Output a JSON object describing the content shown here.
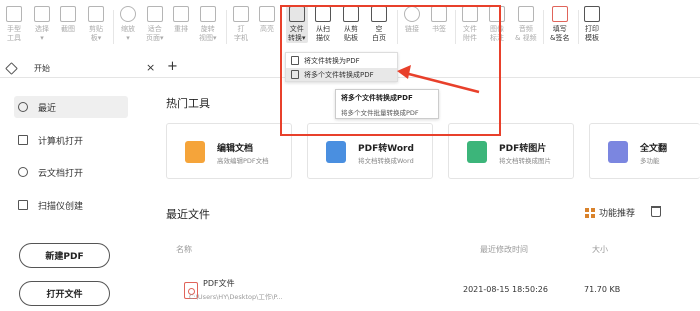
{
  "toolbar": {
    "tools": [
      {
        "name": "hand-tool",
        "label1": "手型",
        "label2": "工具"
      },
      {
        "name": "select-tool",
        "label1": "选择",
        "label2": "▾"
      },
      {
        "name": "screenshot-tool",
        "label1": "截图",
        "label2": ""
      },
      {
        "name": "clipboard-tool",
        "label1": "剪贴",
        "label2": "板▾"
      },
      {
        "name": "zoom-tool",
        "label1": "缩放",
        "label2": "▾"
      },
      {
        "name": "fit-page-tool",
        "label1": "适合",
        "label2": "页面▾"
      },
      {
        "name": "reflow-tool",
        "label1": "重排",
        "label2": ""
      },
      {
        "name": "rotate-view-tool",
        "label1": "旋转",
        "label2": "视图▾"
      },
      {
        "name": "typewriter-tool",
        "label1": "打",
        "label2": "字机"
      },
      {
        "name": "highlight-tool",
        "label1": "高亮",
        "label2": ""
      },
      {
        "name": "file-convert-tool",
        "label1": "文件",
        "label2": "转换▾"
      },
      {
        "name": "from-scanner-tool",
        "label1": "从扫",
        "label2": "描仪"
      },
      {
        "name": "from-clipboard-tool",
        "label1": "从剪",
        "label2": "贴板"
      },
      {
        "name": "blank-page-tool",
        "label1": "空",
        "label2": "白页"
      },
      {
        "name": "link-tool",
        "label1": "链接",
        "label2": ""
      },
      {
        "name": "bookmark-tool",
        "label1": "书签",
        "label2": ""
      },
      {
        "name": "file-attachment-tool",
        "label1": "文件",
        "label2": "附件"
      },
      {
        "name": "image-annotation-tool",
        "label1": "图像",
        "label2": "标注"
      },
      {
        "name": "audio-video-tool",
        "label1": "音频",
        "label2": "& 视频"
      },
      {
        "name": "fill-sign-tool",
        "label1": "填写",
        "label2": "&签名"
      },
      {
        "name": "print-template-tool",
        "label1": "打印",
        "label2": "模板"
      }
    ]
  },
  "dropdown": {
    "items": [
      {
        "label": "将文件转换为PDF"
      },
      {
        "label": "将多个文件转换成PDF"
      }
    ]
  },
  "tooltip": {
    "title": "将多个文件转换成PDF",
    "description": "将多个文件批量转换成PDF"
  },
  "tabbar": {
    "tab_label": "开始",
    "close_glyph": "×",
    "add_glyph": "+"
  },
  "sidebar": {
    "items": [
      {
        "label": "最近"
      },
      {
        "label": "计算机打开"
      },
      {
        "label": "云文档打开"
      },
      {
        "label": "扫描仪创建"
      }
    ],
    "new_pdf_button": "新建PDF",
    "open_file_button": "打开文件"
  },
  "hot_tools": {
    "title": "热门工具",
    "cards": [
      {
        "title": "编辑文档",
        "subtitle": "高效编辑PDF文档",
        "color": "#f5a43a"
      },
      {
        "title": "PDF转Word",
        "subtitle": "将文档转换成Word",
        "color": "#4a8fe0"
      },
      {
        "title": "PDF转图片",
        "subtitle": "将文档转换成图片",
        "color": "#3cb57a"
      },
      {
        "title": "全文翻",
        "subtitle": "多功能",
        "color": "#7b86e0"
      }
    ]
  },
  "recent_files": {
    "title": "最近文件",
    "feature_button": "功能推荐",
    "columns": {
      "name": "名称",
      "modified": "最近修改时间",
      "size": "大小"
    },
    "rows": [
      {
        "name": "PDF文件",
        "path": "C:\\Users\\HY\\Desktop\\工作\\P...",
        "modified": "2021-08-15 18:50:26",
        "size": "71.70 KB"
      }
    ]
  },
  "colors": {
    "annotation_red": "#e8402b",
    "accent_orange": "#d9822b"
  }
}
